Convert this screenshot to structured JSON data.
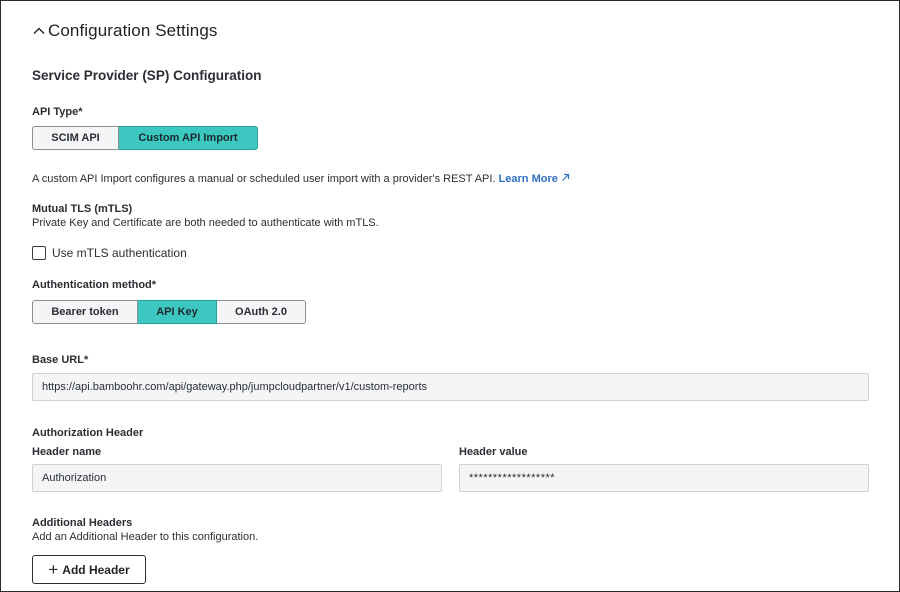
{
  "section": {
    "title": "Configuration Settings",
    "toggle_icon": "chevron-up-icon"
  },
  "sp": {
    "title": "Service Provider (SP) Configuration"
  },
  "api_type": {
    "label": "API Type*",
    "options": [
      "SCIM API",
      "Custom API Import"
    ],
    "selected": "Custom API Import",
    "description": "A custom API Import configures a manual or scheduled user import with a provider's REST API.",
    "learn_more": "Learn More",
    "learn_more_icon": "external-link-icon"
  },
  "mtls": {
    "title": "Mutual TLS (mTLS)",
    "description": "Private Key and Certificate are both needed to authenticate with mTLS.",
    "checkbox_label": "Use mTLS authentication",
    "checked": false
  },
  "auth_method": {
    "label": "Authentication method*",
    "options": [
      "Bearer token",
      "API Key",
      "OAuth 2.0"
    ],
    "selected": "API Key"
  },
  "base_url": {
    "label": "Base URL*",
    "value": "https://api.bamboohr.com/api/gateway.php/jumpcloudpartner/v1/custom-reports"
  },
  "authorization_header": {
    "title": "Authorization Header",
    "name_label": "Header name",
    "name_value": "Authorization",
    "value_label": "Header value",
    "value_value": "******************"
  },
  "additional_headers": {
    "title": "Additional Headers",
    "description": "Add an Additional Header to this configuration.",
    "button_label": "Add Header",
    "button_icon": "plus-icon"
  },
  "colors": {
    "accent": "#3cc7c1",
    "link": "#2f6fc2",
    "input_bg": "#f4f5f6"
  }
}
